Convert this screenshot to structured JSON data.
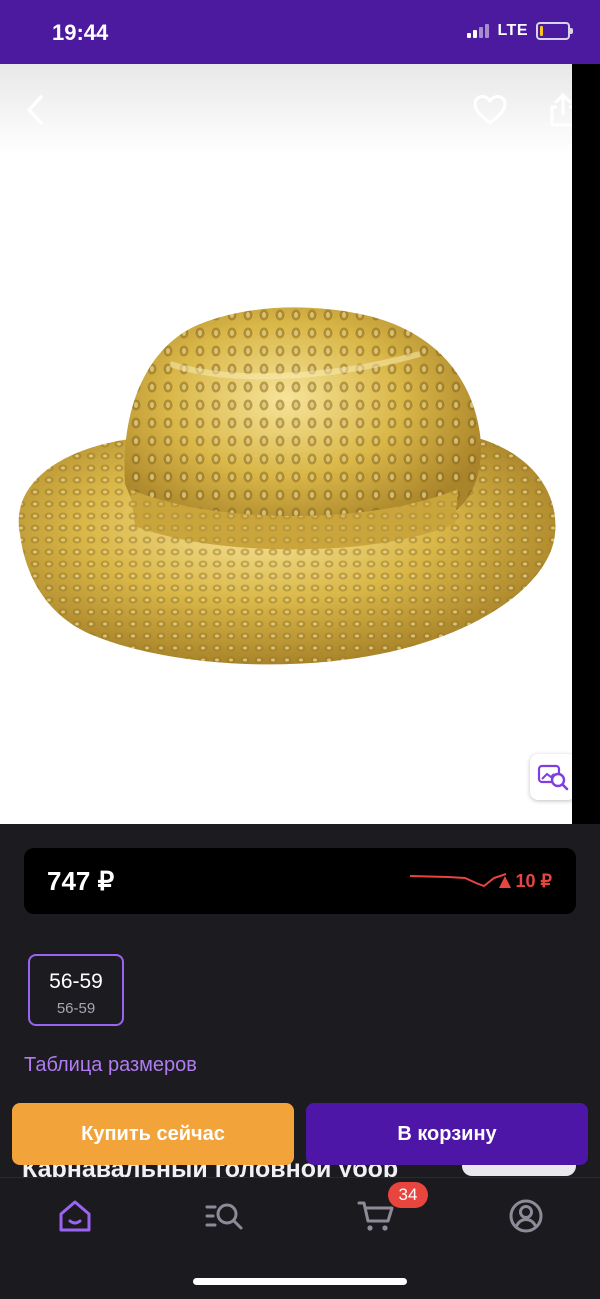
{
  "status_bar": {
    "time": "19:44",
    "network": "LTE",
    "battery_color": "#f5c518"
  },
  "product_image": {
    "back_icon": "chevron-left-icon",
    "favorite_icon": "heart-outline-icon",
    "share_icon": "share-icon",
    "visual_search_icon": "image-search-icon"
  },
  "price": {
    "current": "747 ₽",
    "change": "10 ₽",
    "trend": "up",
    "trend_color": "#e9453f"
  },
  "size": {
    "selected": "56-59",
    "secondary": "56-59"
  },
  "size_table_link": "Таблица размеров",
  "product_title": "Карнавальный головной убор",
  "actions": {
    "buy_now": "Купить сейчас",
    "add_to_cart": "В корзину"
  },
  "tabbar": {
    "items": [
      {
        "name": "home",
        "icon": "home-icon",
        "active": true
      },
      {
        "name": "catalog",
        "icon": "catalog-search-icon",
        "active": false
      },
      {
        "name": "cart",
        "icon": "cart-icon",
        "active": false
      },
      {
        "name": "profile",
        "icon": "user-icon",
        "active": false
      }
    ],
    "cart_badge": "34"
  },
  "colors": {
    "brand_purple": "#4b1a9e",
    "accent_purple": "#9a63f2",
    "buy_orange": "#f2a33a",
    "cart_purple": "#4d16a6",
    "background": "#1c1b20"
  }
}
